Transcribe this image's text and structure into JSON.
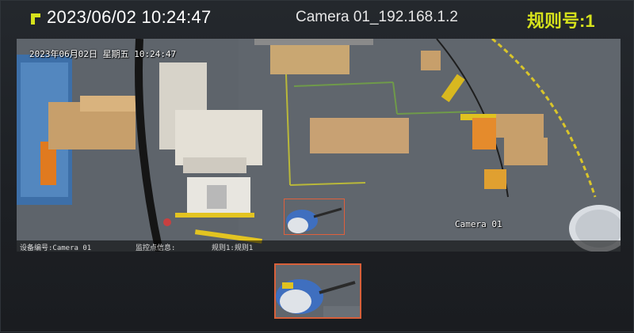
{
  "header": {
    "datetime": "2023/06/02 10:24:47",
    "camera_name": "Camera 01_192.168.1.2",
    "rule_number": "规则号:1",
    "accent_color": "#d6e21c"
  },
  "video": {
    "osd_timestamp": "2023年06月02日 星期五 10:24:47",
    "osd_camera_label": "Camera 01",
    "osd_device": "设备编号:Camera 01",
    "osd_monitor": "监控点信息:",
    "osd_rule": "规则1:规则1",
    "detection_color": "#e0603c"
  },
  "thumbnail": {
    "border_color": "#d8603a"
  }
}
